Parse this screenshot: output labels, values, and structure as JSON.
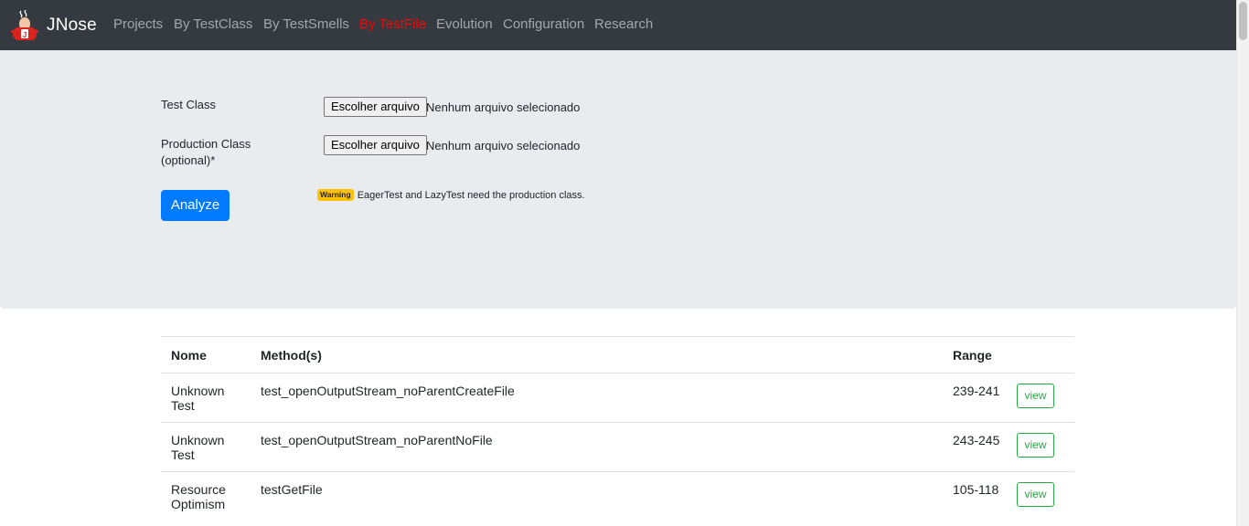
{
  "navbar": {
    "brand": "JNose",
    "items": [
      {
        "label": "Projects",
        "active": false
      },
      {
        "label": "By TestClass",
        "active": false
      },
      {
        "label": "By TestSmells",
        "active": false
      },
      {
        "label": "By TestFile",
        "active": true
      },
      {
        "label": "Evolution",
        "active": false
      },
      {
        "label": "Configuration",
        "active": false
      },
      {
        "label": "Research",
        "active": false
      }
    ]
  },
  "form": {
    "test_class_label": "Test Class",
    "production_class_label_line1": "Production Class",
    "production_class_label_line2": "(optional)*",
    "choose_file_label": "Escolher arquivo",
    "no_file_text": "Nenhum arquivo selecionado",
    "analyze_label": "Analyze",
    "warning_badge": "Warning",
    "warning_text": "EagerTest and LazyTest need the production class."
  },
  "table": {
    "headers": [
      "Nome",
      "Method(s)",
      "Range",
      ""
    ],
    "rows": [
      {
        "name_line1": "Unknown",
        "name_line2": "Test",
        "method": "test_openOutputStream_noParentCreateFile",
        "range": "239-241",
        "action": "view"
      },
      {
        "name_line1": "Unknown",
        "name_line2": "Test",
        "method": "test_openOutputStream_noParentNoFile",
        "range": "243-245",
        "action": "view"
      },
      {
        "name_line1": "Resource",
        "name_line2": "Optimism",
        "method": "testGetFile",
        "range": "105-118",
        "action": "view"
      }
    ]
  },
  "colors": {
    "navbar_bg": "#343a40",
    "active_nav": "#ff0000",
    "primary": "#007bff",
    "success": "#28a745",
    "warning": "#ffc107"
  }
}
